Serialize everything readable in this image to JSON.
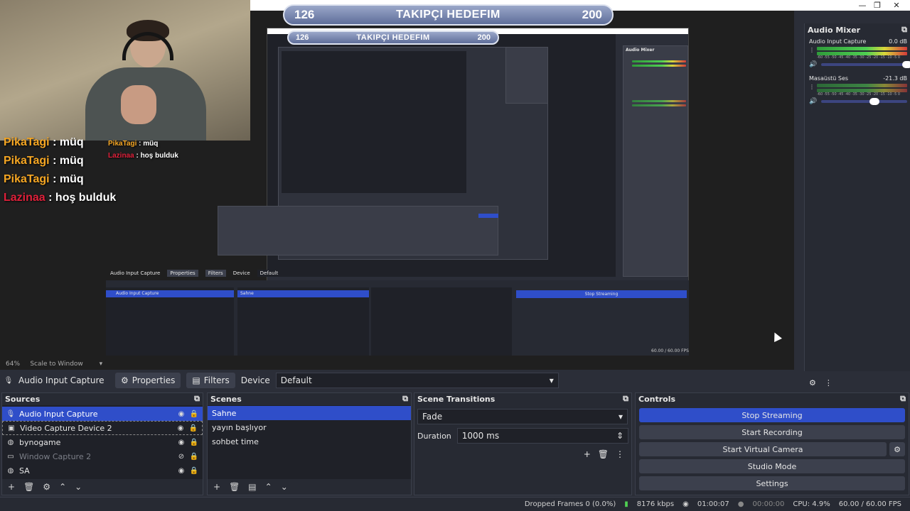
{
  "window": {
    "minimize": "—",
    "restore": "❐",
    "close": "✕"
  },
  "goal_banner": {
    "current": "126",
    "label": "TAKIPÇI HEDEFIM",
    "target": "200"
  },
  "chat": [
    {
      "user": "PikaTagi",
      "message": ": müq"
    },
    {
      "user": "PikaTagi",
      "message": ": müq"
    },
    {
      "user": "PikaTagi",
      "message": ": müq"
    },
    {
      "user": "Lazinaa",
      "message": ": hoş bulduk"
    }
  ],
  "nested_chat": [
    {
      "user": "PikaTagi",
      "message": ": müq"
    },
    {
      "user": "Lazinaa",
      "message": ": hoş bulduk"
    }
  ],
  "zoom": {
    "level": "64%",
    "mode": "Scale to Window"
  },
  "source_bar": {
    "source_name": "Audio Input Capture",
    "properties": "Properties",
    "filters": "Filters",
    "device_label": "Device",
    "device_value": "Default"
  },
  "sources": {
    "title": "Sources",
    "items": [
      {
        "name": "Audio Input Capture",
        "icon": "mic-icon"
      },
      {
        "name": "Video Capture Device 2",
        "icon": "camera-icon"
      },
      {
        "name": "bynogame",
        "icon": "globe-icon"
      },
      {
        "name": "Window Capture 2",
        "icon": "window-icon"
      },
      {
        "name": "SA",
        "icon": "globe-icon"
      }
    ]
  },
  "scenes": {
    "title": "Scenes",
    "items": [
      "Sahne",
      "yayın başlıyor",
      "sohbet time"
    ]
  },
  "transitions": {
    "title": "Scene Transitions",
    "type": "Fade",
    "duration_label": "Duration",
    "duration_value": "1000 ms"
  },
  "controls": {
    "title": "Controls",
    "stop_streaming": "Stop Streaming",
    "start_recording": "Start Recording",
    "start_virtual_camera": "Start Virtual Camera",
    "studio_mode": "Studio Mode",
    "settings": "Settings"
  },
  "mixer": {
    "title": "Audio Mixer",
    "channels": [
      {
        "name": "Audio Input Capture",
        "db": "0.0 dB",
        "level": 0.97,
        "volume": 0.9
      },
      {
        "name": "Masaüstü Ses",
        "db": "-21.3 dB",
        "level": 0.6,
        "volume": 0.58
      }
    ],
    "scale": "-60 -55 -50 -45 -40 -35 -30 -25 -20 -15 -10 -5 0"
  },
  "status": {
    "dropped_frames": "Dropped Frames 0 (0.0%)",
    "bitrate": "8176 kbps",
    "stream_time": "01:00:07",
    "rec_time": "00:00:00",
    "cpu": "CPU: 4.9%",
    "fps": "60.00 / 60.00 FPS"
  },
  "colors": {
    "accent": "#2f4ec9",
    "panel": "#272a33",
    "background": "#2b2e38"
  }
}
